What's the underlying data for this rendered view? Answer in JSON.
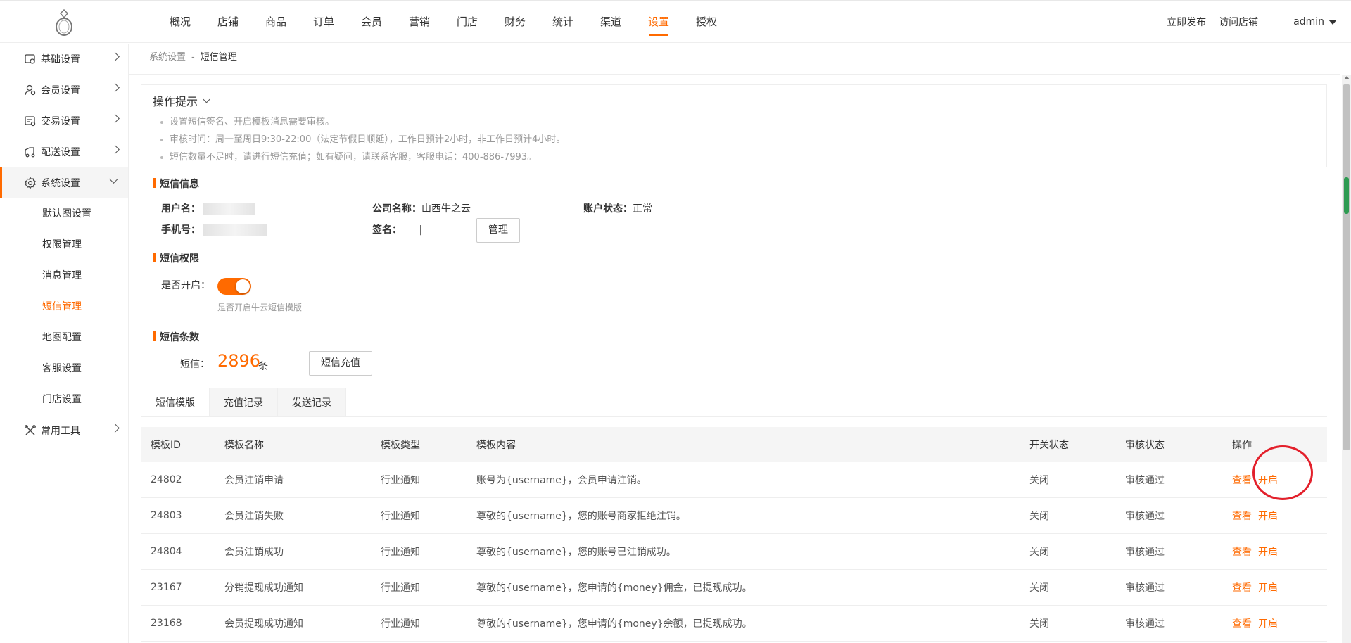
{
  "nav": {
    "items": [
      "概况",
      "店铺",
      "商品",
      "订单",
      "会员",
      "营销",
      "门店",
      "财务",
      "统计",
      "渠道",
      "设置",
      "授权"
    ],
    "active_index": 10,
    "publish": "立即发布",
    "visit": "访问店铺",
    "user": "admin"
  },
  "sidebar": {
    "items": [
      {
        "label": "基础设置",
        "icon": "settings-page-icon"
      },
      {
        "label": "会员设置",
        "icon": "member-icon"
      },
      {
        "label": "交易设置",
        "icon": "trade-icon"
      },
      {
        "label": "配送设置",
        "icon": "delivery-icon"
      },
      {
        "label": "系统设置",
        "icon": "gear-icon"
      },
      {
        "label": "常用工具",
        "icon": "tools-icon"
      }
    ],
    "sub_items": [
      "默认图设置",
      "权限管理",
      "消息管理",
      "短信管理",
      "地图配置",
      "客服设置",
      "门店设置"
    ],
    "active_sub": 3
  },
  "breadcrumb": {
    "parent": "系统设置",
    "sep": "-",
    "current": "短信管理"
  },
  "tips": {
    "title": "操作提示",
    "lines": [
      "设置短信签名、开启模板消息需要审核。",
      "审核时间：周一至周日9:30-22:00（法定节假日顺延），工作日预计2小时，非工作日预计4小时。",
      "短信数量不足时，请进行短信充值；如有疑问，请联系客服，客服电话：400-886-7993。"
    ]
  },
  "sms_info": {
    "title": "短信信息",
    "username_label": "用户名：",
    "phone_label": "手机号：",
    "company_label": "公司名称：",
    "company_value": "山西牛之云",
    "sign_label": "签名：",
    "sign_value": "|",
    "manage_button": "管理",
    "status_label": "账户状态：",
    "status_value": "正常"
  },
  "sms_permission": {
    "title": "短信权限",
    "enable_label": "是否开启：",
    "enabled": true,
    "hint": "是否开启牛云短信模版"
  },
  "sms_count": {
    "title": "短信条数",
    "label": "短信：",
    "value": "2896",
    "unit": "条",
    "recharge_button": "短信充值"
  },
  "tabs": [
    "短信模版",
    "充值记录",
    "发送记录"
  ],
  "table": {
    "headers": [
      "模板ID",
      "模板名称",
      "模板类型",
      "模板内容",
      "开关状态",
      "审核状态",
      "操作"
    ],
    "rows": [
      {
        "id": "24802",
        "name": "会员注销申请",
        "type": "行业通知",
        "content": "账号为{username}，会员申请注销。",
        "switch": "关闭",
        "audit": "审核通过",
        "view": "查看",
        "enable": "开启"
      },
      {
        "id": "24803",
        "name": "会员注销失败",
        "type": "行业通知",
        "content": "尊敬的{username}，您的账号商家拒绝注销。",
        "switch": "关闭",
        "audit": "审核通过",
        "view": "查看",
        "enable": "开启"
      },
      {
        "id": "24804",
        "name": "会员注销成功",
        "type": "行业通知",
        "content": "尊敬的{username}，您的账号已注销成功。",
        "switch": "关闭",
        "audit": "审核通过",
        "view": "查看",
        "enable": "开启"
      },
      {
        "id": "23167",
        "name": "分销提现成功通知",
        "type": "行业通知",
        "content": "尊敬的{username}，您申请的{money}佣金，已提现成功。",
        "switch": "关闭",
        "audit": "审核通过",
        "view": "查看",
        "enable": "开启"
      },
      {
        "id": "23168",
        "name": "会员提现成功通知",
        "type": "行业通知",
        "content": "尊敬的{username}，您申请的{money}余额，已提现成功。",
        "switch": "关闭",
        "audit": "审核通过",
        "view": "查看",
        "enable": "开启"
      }
    ]
  },
  "colors": {
    "accent": "#ff6a00",
    "annotation": "#e3202b"
  }
}
